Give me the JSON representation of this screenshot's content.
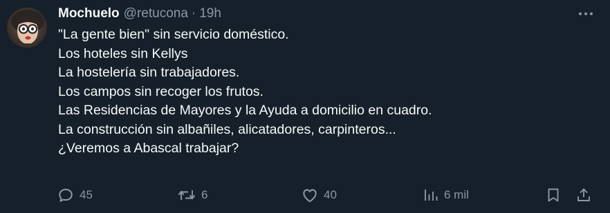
{
  "tweet": {
    "display_name": "Mochuelo",
    "handle": "@retucona",
    "separator": "·",
    "time": "19h",
    "lines": [
      "\"La gente bien\" sin servicio doméstico.",
      "Los hoteles sin Kellys",
      "La hostelería sin trabajadores.",
      "Los campos sin recoger los frutos.",
      "Las Residencias de Mayores y la Ayuda a domicilio en cuadro.",
      "La construcción sin albañiles, alicatadores, carpinteros...",
      "¿Veremos a Abascal trabajar?"
    ]
  },
  "actions": {
    "replies": "45",
    "retweets": "6",
    "likes": "40",
    "views": "6 mil"
  },
  "icons": {
    "more": "more-horizontal-icon",
    "reply": "reply-icon",
    "retweet": "retweet-icon",
    "like": "heart-icon",
    "views": "views-icon",
    "bookmark": "bookmark-icon",
    "share": "share-icon"
  },
  "colors": {
    "background": "#15202b",
    "text": "#f7f9f9",
    "secondary": "#8b98a5"
  }
}
